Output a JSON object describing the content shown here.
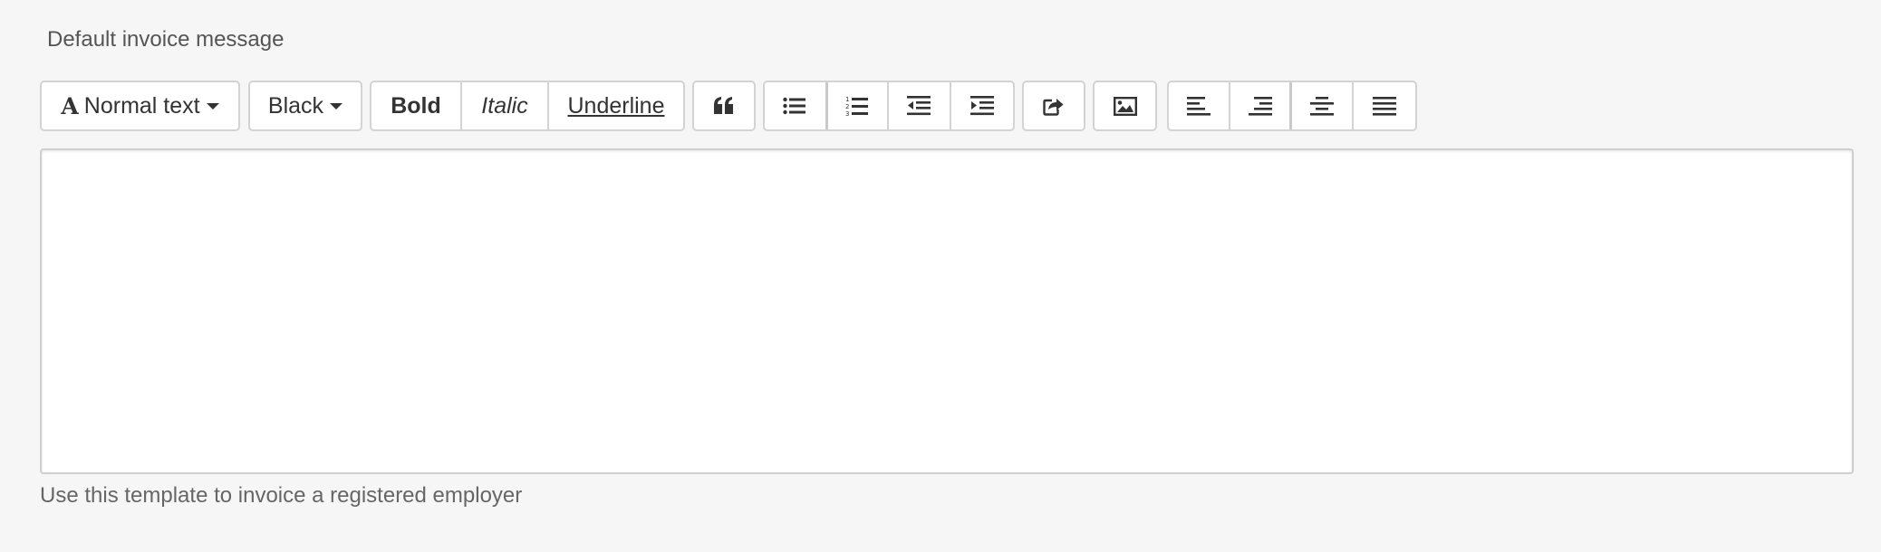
{
  "field": {
    "label": "Default invoice message",
    "help_text": "Use this template to invoice a registered employer",
    "editor_value": ""
  },
  "toolbar": {
    "font_style": {
      "icon_letter": "A",
      "label": "Normal text"
    },
    "color": {
      "label": "Black"
    },
    "format": {
      "bold": "Bold",
      "italic": "Italic",
      "underline": "Underline"
    },
    "icons": [
      "quote-icon",
      "bullet-list-icon",
      "numbered-list-icon",
      "outdent-icon",
      "indent-icon",
      "share-link-icon",
      "image-icon",
      "align-left-icon",
      "align-right-icon",
      "align-center-icon",
      "align-justify-icon"
    ]
  },
  "colors": {
    "background": "#f6f6f6",
    "button_border": "#d3d3d3",
    "text": "#333333",
    "muted_text": "#666666"
  }
}
